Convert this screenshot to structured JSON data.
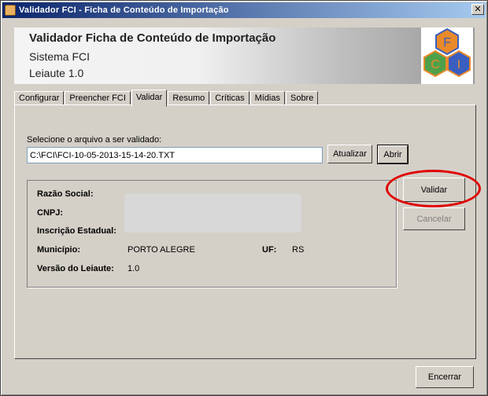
{
  "window": {
    "title": "Validador FCI - Ficha de Conteúdo de Importação",
    "close_glyph": "✕"
  },
  "header": {
    "title": "Validador Ficha de Conteúdo de Importação",
    "subtitle": "Sistema FCI",
    "version": "Leiaute 1.0",
    "logo_letters": [
      "F",
      "C",
      "I"
    ]
  },
  "tabs": [
    "Configurar",
    "Preencher FCI",
    "Validar",
    "Resumo",
    "Críticas",
    "Mídias",
    "Sobre"
  ],
  "active_tab": "Validar",
  "file": {
    "label": "Selecione o arquivo a ser validado:",
    "value": "C:\\FCI\\FCI-10-05-2013-15-14-20.TXT",
    "refresh_label": "Atualizar",
    "open_label": "Abrir"
  },
  "info": {
    "razao_label": "Razão Social:",
    "razao_value": "",
    "cnpj_label": "CNPJ:",
    "cnpj_value": "",
    "ie_label": "Inscrição Estadual:",
    "ie_value": "",
    "municipio_label": "Município:",
    "municipio_value": "PORTO ALEGRE",
    "uf_label": "UF:",
    "uf_value": "RS",
    "versao_label": "Versão do Leiaute:",
    "versao_value": "1.0"
  },
  "actions": {
    "validate_label": "Validar",
    "cancel_label": "Cancelar",
    "close_label": "Encerrar"
  },
  "colors": {
    "title_bar": "#0a246a",
    "highlight": "#e00000",
    "logo_orange": "#e8892a",
    "logo_green": "#4fa04a",
    "logo_blue": "#3a5fc0"
  }
}
